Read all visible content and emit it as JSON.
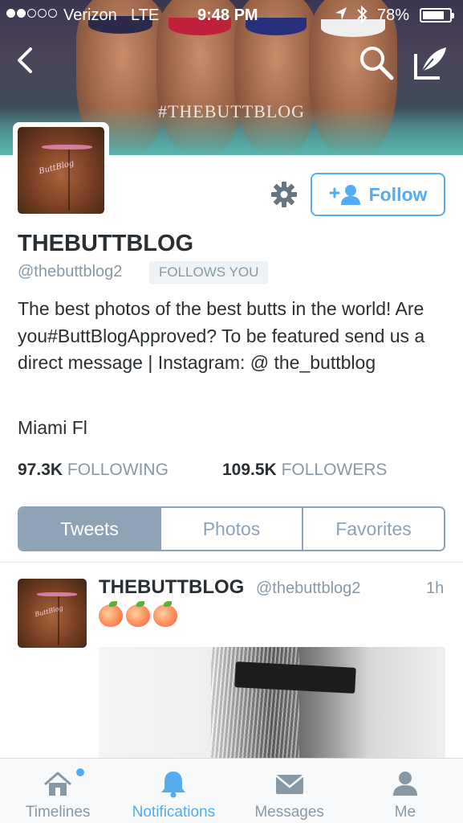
{
  "status_bar": {
    "carrier": "Verizon",
    "network": "LTE",
    "time": "9:48 PM",
    "battery_percent": "78%"
  },
  "banner": {
    "hashtag": "#THEBUTTBLOG"
  },
  "profile": {
    "display_name": "THEBUTTBLOG",
    "handle": "@thebuttblog2",
    "follows_you_label": "FOLLOWS YOU",
    "follow_label": "Follow",
    "bio": "The best photos of the best butts in the world! Are you#ButtBlogApproved? To be featured send us a direct message | Instagram: @ the_buttblog",
    "location": "Miami Fl",
    "following_count": "97.3K",
    "following_label": "FOLLOWING",
    "followers_count": "109.5K",
    "followers_label": "FOLLOWERS",
    "avatar_caption": "ButtBlog"
  },
  "tabs": [
    {
      "label": "Tweets",
      "active": true
    },
    {
      "label": "Photos",
      "active": false
    },
    {
      "label": "Favorites",
      "active": false
    }
  ],
  "tweet": {
    "name": "THEBUTTBLOG",
    "handle": "@thebuttblog2",
    "time": "1h",
    "emoji": [
      "peach",
      "peach",
      "peach"
    ]
  },
  "tabbar": [
    {
      "label": "Timelines",
      "icon": "home-icon",
      "active": false
    },
    {
      "label": "Notifications",
      "icon": "bell-icon",
      "active": true
    },
    {
      "label": "Messages",
      "icon": "envelope-icon",
      "active": false
    },
    {
      "label": "Me",
      "icon": "person-icon",
      "active": false
    }
  ],
  "colors": {
    "accent": "#55acee",
    "tab_active_bg": "#8ea3b6",
    "muted_text": "#8899a6",
    "primary_text": "#292f33"
  }
}
